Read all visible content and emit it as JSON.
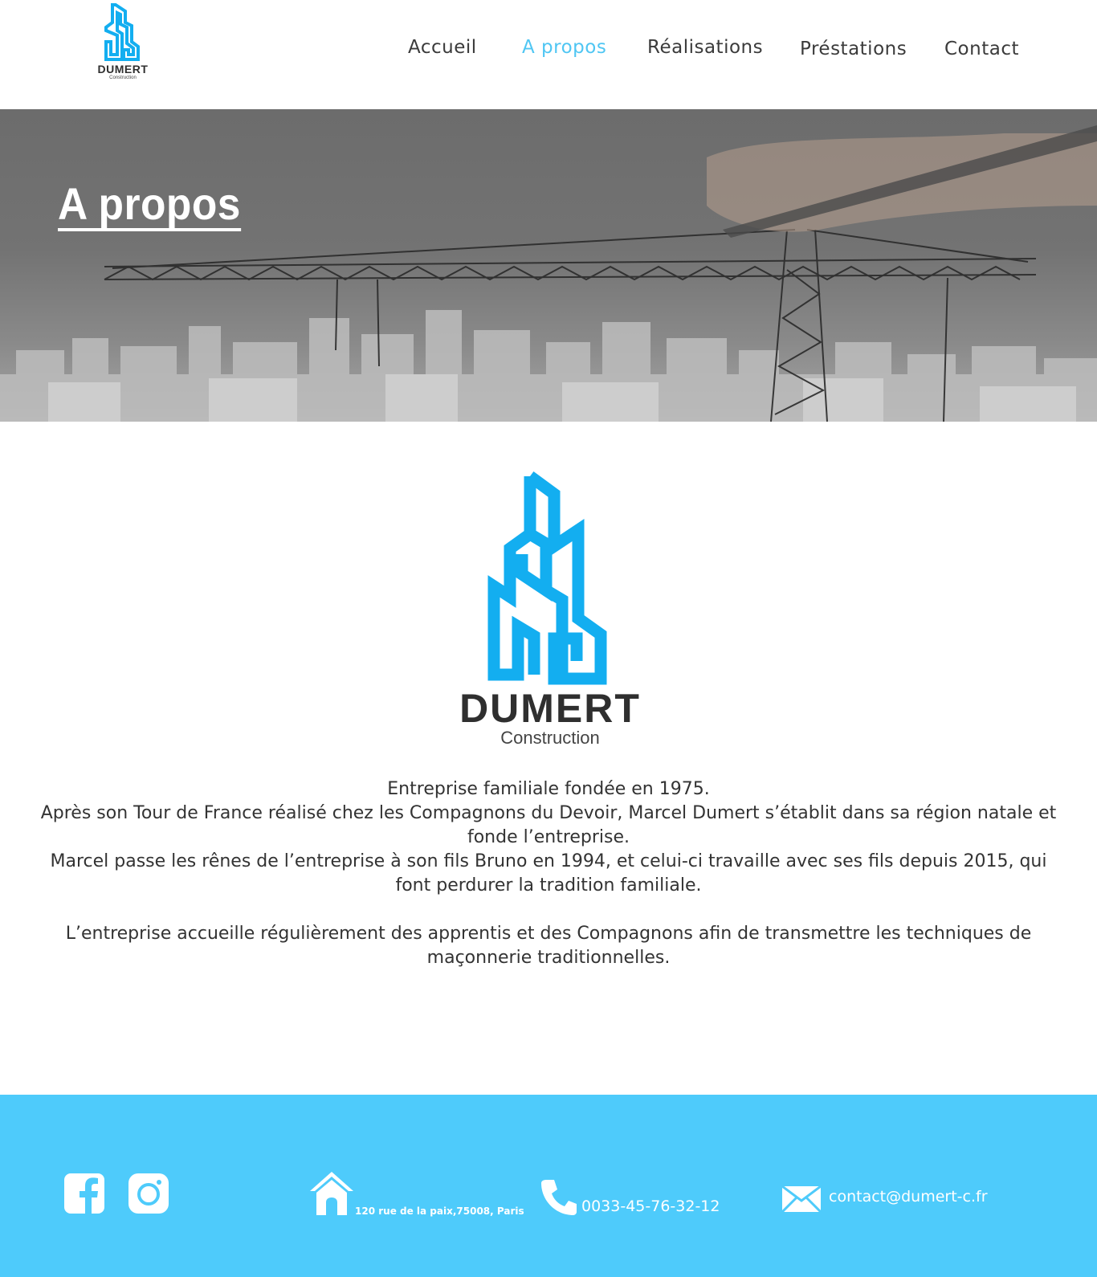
{
  "header": {
    "logo": {
      "name": "DUMERT",
      "sub": "Construction"
    },
    "nav": [
      {
        "label": "Accueil",
        "active": false
      },
      {
        "label": "A propos",
        "active": true
      },
      {
        "label": "Réalisations",
        "active": false
      },
      {
        "label": "Préstations",
        "active": false
      },
      {
        "label": "Contact",
        "active": false
      }
    ]
  },
  "hero": {
    "title": "A propos"
  },
  "main": {
    "logo": {
      "name": "DUMERT",
      "sub": "Construction"
    },
    "paragraphs": [
      "Entreprise familiale fondée en 1975.",
      "Après son Tour de France réalisé chez les Compagnons du Devoir, Marcel Dumert s’établit dans sa région natale et fonde l’entreprise.",
      "Marcel passe les rênes de l’entreprise à son fils Bruno en 1994, et celui-ci travaille avec ses fils depuis 2015, qui font perdurer la tradition familiale.",
      "L’entreprise accueille régulièrement des apprentis et des Compagnons afin de transmettre les techniques de maçonnerie traditionnelles."
    ]
  },
  "footer": {
    "social": [
      {
        "icon": "facebook-icon"
      },
      {
        "icon": "instagram-icon"
      }
    ],
    "address": "120 rue de la paix,75008, Paris",
    "phone": "0033-45-76-32-12",
    "email": "contact@dumert-c.fr"
  },
  "colors": {
    "accent": "#4fc6f3",
    "footer": "#4ecbfb",
    "logo_blue": "#13aef0",
    "text": "#333333"
  }
}
